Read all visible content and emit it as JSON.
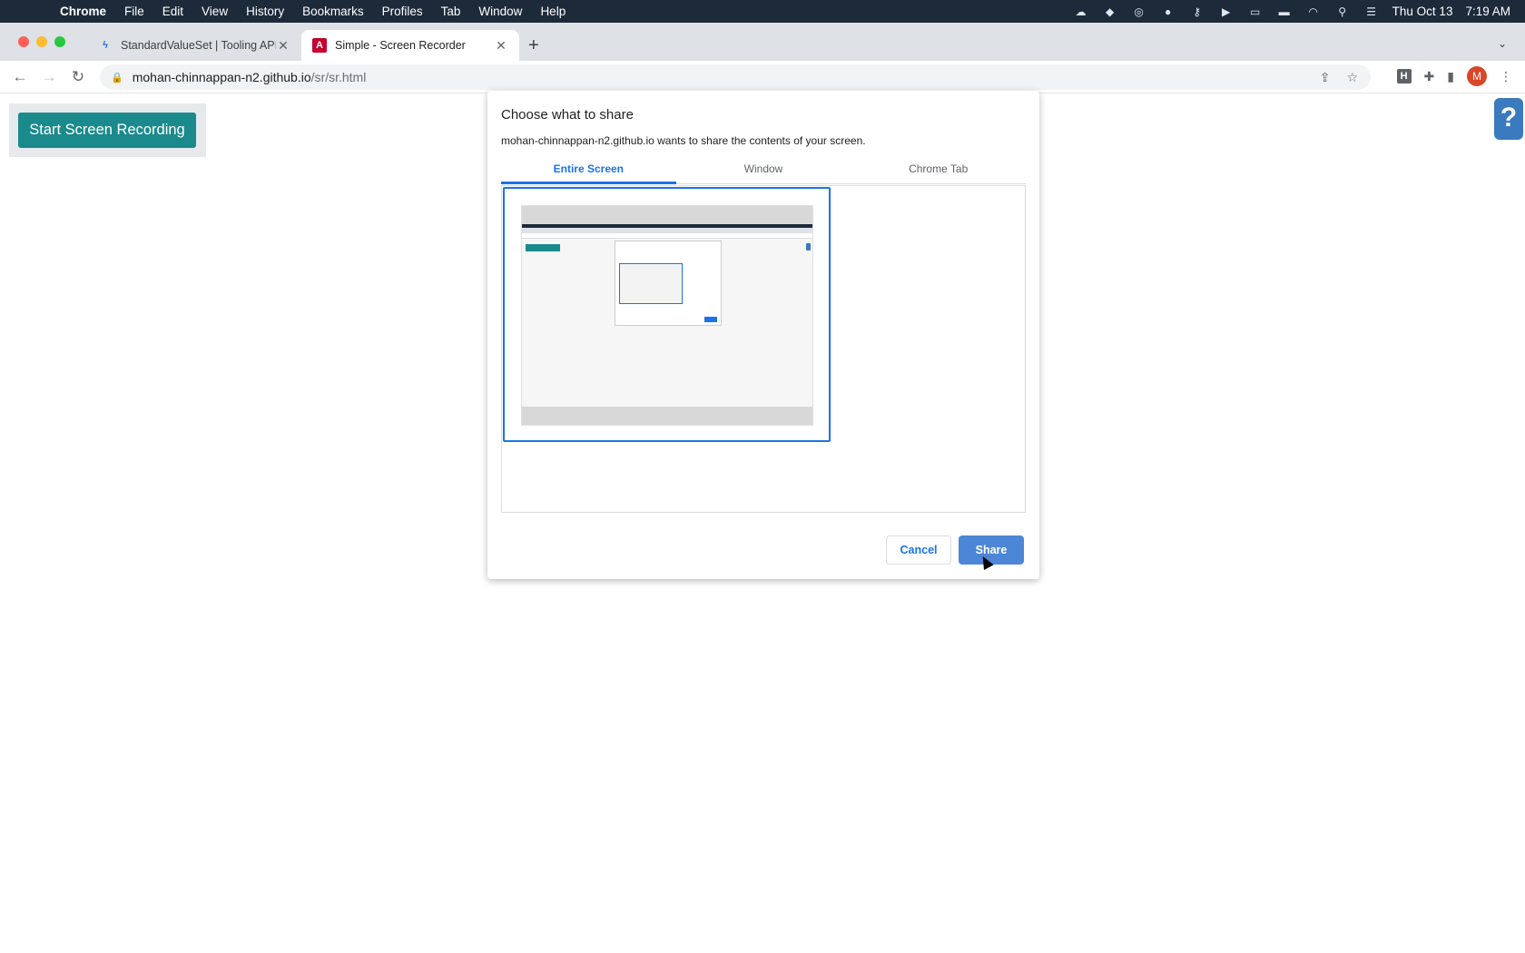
{
  "menubar": {
    "app": "Chrome",
    "items": [
      "File",
      "Edit",
      "View",
      "History",
      "Bookmarks",
      "Profiles",
      "Tab",
      "Window",
      "Help"
    ],
    "date": "Thu Oct 13",
    "time": "7:19 AM"
  },
  "tabs": [
    {
      "title": "StandardValueSet | Tooling API"
    },
    {
      "title": "Simple - Screen Recorder"
    }
  ],
  "address": {
    "host": "mohan-chinnappan-n2.github.io",
    "path": "/sr/sr.html"
  },
  "profile_initial": "M",
  "extension_label": "H",
  "page": {
    "record_button": "Start Screen Recording",
    "help_label": "?"
  },
  "dialog": {
    "title": "Choose what to share",
    "subtitle": "mohan-chinnappan-n2.github.io wants to share the contents of your screen.",
    "tabs": [
      "Entire Screen",
      "Window",
      "Chrome Tab"
    ],
    "cancel": "Cancel",
    "share": "Share"
  },
  "colors": {
    "record_button": "#1a8a8c",
    "accent": "#1a73e8",
    "share_button": "#4d86d6"
  }
}
